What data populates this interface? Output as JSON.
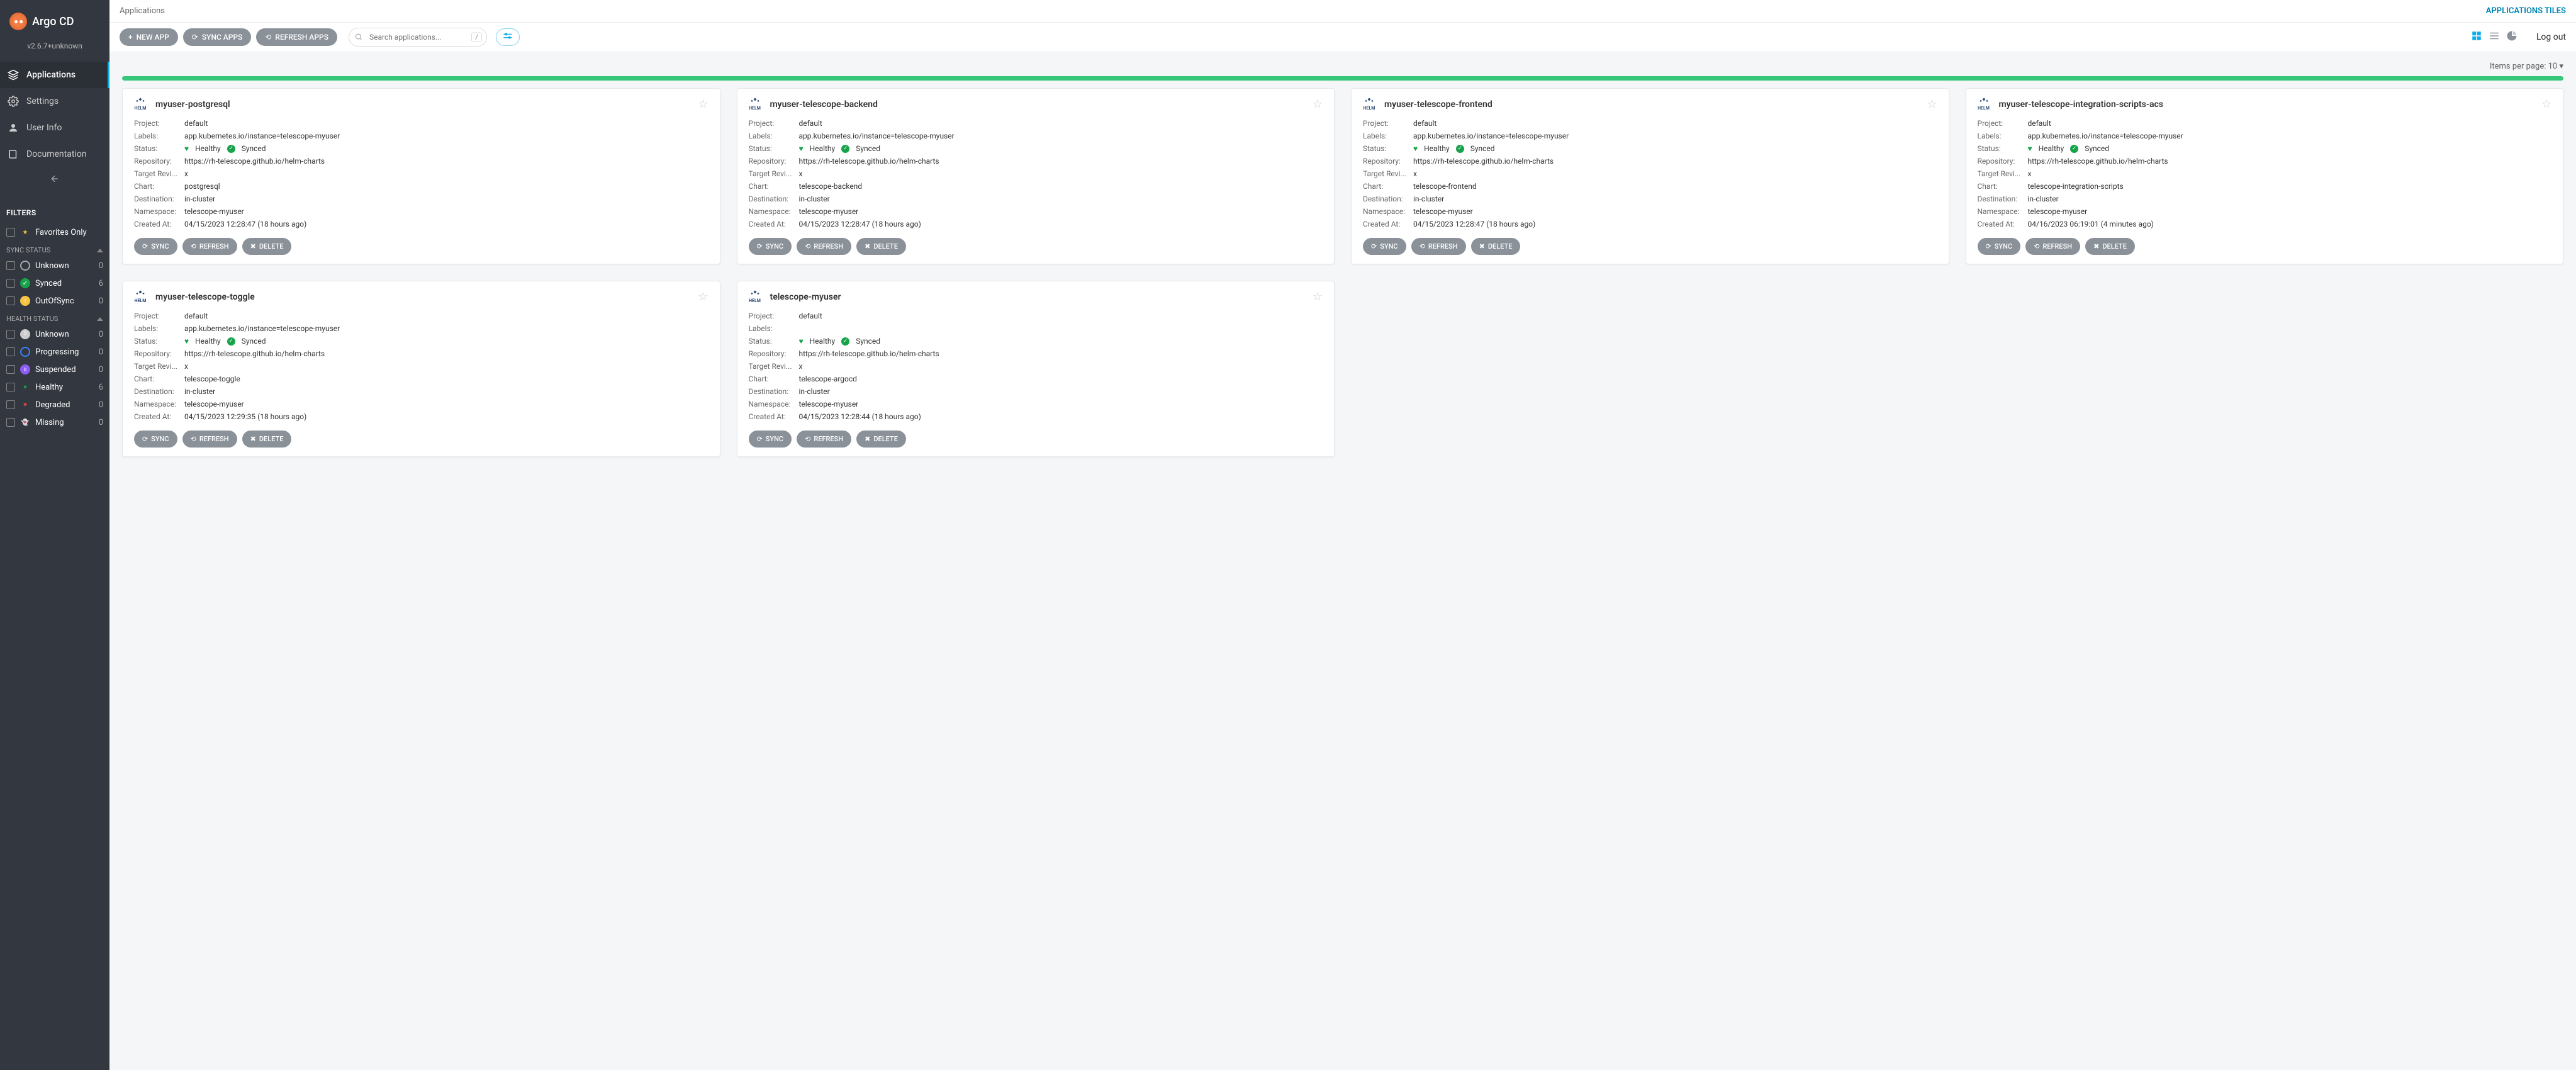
{
  "branding": {
    "name": "Argo CD",
    "version": "v2.6.7+unknown"
  },
  "nav": {
    "applications": "Applications",
    "settings": "Settings",
    "user_info": "User Info",
    "documentation": "Documentation"
  },
  "filters": {
    "title": "FILTERS",
    "favorites_only": "Favorites Only",
    "sync_status_title": "SYNC STATUS",
    "sync": {
      "unknown": {
        "label": "Unknown",
        "count": "0"
      },
      "synced": {
        "label": "Synced",
        "count": "6"
      },
      "outofsync": {
        "label": "OutOfSync",
        "count": "0"
      }
    },
    "health_status_title": "HEALTH STATUS",
    "health": {
      "unknown": {
        "label": "Unknown",
        "count": "0"
      },
      "progressing": {
        "label": "Progressing",
        "count": "0"
      },
      "suspended": {
        "label": "Suspended",
        "count": "0"
      },
      "healthy": {
        "label": "Healthy",
        "count": "6"
      },
      "degraded": {
        "label": "Degraded",
        "count": "0"
      },
      "missing": {
        "label": "Missing",
        "count": "0"
      }
    }
  },
  "header": {
    "breadcrumb": "Applications",
    "tiles_link": "APPLICATIONS TILES"
  },
  "toolbar": {
    "new_app": "NEW APP",
    "sync_apps": "SYNC APPS",
    "refresh_apps": "REFRESH APPS",
    "search_placeholder": "Search applications...",
    "slash": "/",
    "logout": "Log out"
  },
  "paging": {
    "label": "Items per page: ",
    "value": "10"
  },
  "field_labels": {
    "project": "Project:",
    "labels": "Labels:",
    "status": "Status:",
    "repository": "Repository:",
    "target_rev": "Target Revi...",
    "chart": "Chart:",
    "destination": "Destination:",
    "namespace": "Namespace:",
    "created_at": "Created At:"
  },
  "status_text": {
    "healthy": "Healthy",
    "synced": "Synced"
  },
  "card_buttons": {
    "sync": "SYNC",
    "refresh": "REFRESH",
    "delete": "DELETE"
  },
  "apps": [
    {
      "name": "myuser-postgresql",
      "project": "default",
      "labels": "app.kubernetes.io/instance=telescope-myuser",
      "repository": "https://rh-telescope.github.io/helm-charts",
      "target_rev": "x",
      "chart": "postgresql",
      "destination": "in-cluster",
      "namespace": "telescope-myuser",
      "created_at": "04/15/2023 12:28:47  (18 hours ago)"
    },
    {
      "name": "myuser-telescope-backend",
      "project": "default",
      "labels": "app.kubernetes.io/instance=telescope-myuser",
      "repository": "https://rh-telescope.github.io/helm-charts",
      "target_rev": "x",
      "chart": "telescope-backend",
      "destination": "in-cluster",
      "namespace": "telescope-myuser",
      "created_at": "04/15/2023 12:28:47  (18 hours ago)"
    },
    {
      "name": "myuser-telescope-frontend",
      "project": "default",
      "labels": "app.kubernetes.io/instance=telescope-myuser",
      "repository": "https://rh-telescope.github.io/helm-charts",
      "target_rev": "x",
      "chart": "telescope-frontend",
      "destination": "in-cluster",
      "namespace": "telescope-myuser",
      "created_at": "04/15/2023 12:28:47  (18 hours ago)"
    },
    {
      "name": "myuser-telescope-integration-scripts-acs",
      "project": "default",
      "labels": "app.kubernetes.io/instance=telescope-myuser",
      "repository": "https://rh-telescope.github.io/helm-charts",
      "target_rev": "x",
      "chart": "telescope-integration-scripts",
      "destination": "in-cluster",
      "namespace": "telescope-myuser",
      "created_at": "04/16/2023 06:19:01  (4 minutes ago)"
    },
    {
      "name": "myuser-telescope-toggle",
      "project": "default",
      "labels": "app.kubernetes.io/instance=telescope-myuser",
      "repository": "https://rh-telescope.github.io/helm-charts",
      "target_rev": "x",
      "chart": "telescope-toggle",
      "destination": "in-cluster",
      "namespace": "telescope-myuser",
      "created_at": "04/15/2023 12:29:35  (18 hours ago)"
    },
    {
      "name": "telescope-myuser",
      "project": "default",
      "labels": "",
      "repository": "https://rh-telescope.github.io/helm-charts",
      "target_rev": "x",
      "chart": "telescope-argocd",
      "destination": "in-cluster",
      "namespace": "telescope-myuser",
      "created_at": "04/15/2023 12:28:44  (18 hours ago)"
    }
  ]
}
